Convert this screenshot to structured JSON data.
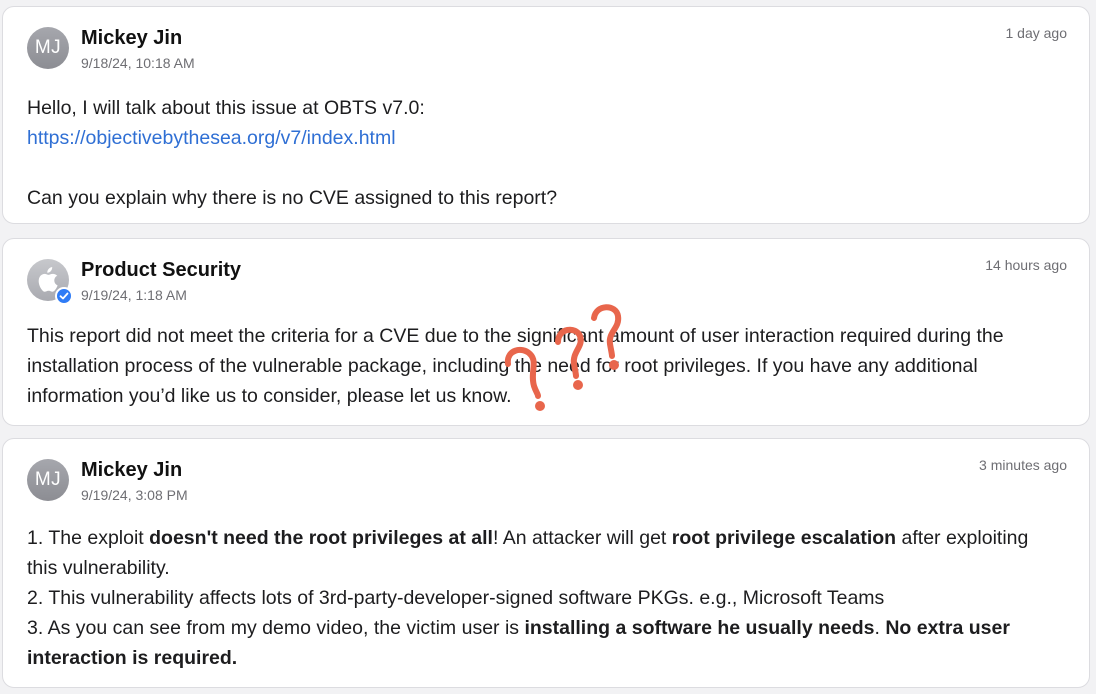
{
  "messages": [
    {
      "author": "Mickey Jin",
      "avatar_initials": "MJ",
      "date": "9/18/24, 10:18 AM",
      "relative_time": "1 day ago",
      "line1": "Hello, I will talk about this issue at OBTS v7.0:",
      "link": "https://objectivebythesea.org/v7/index.html",
      "line3": "Can you explain why there is no CVE assigned to this report?"
    },
    {
      "author": "Product Security",
      "avatar_icon": "apple-logo-icon",
      "verified_icon": "verified-check-icon",
      "date": "9/19/24, 1:18 AM",
      "relative_time": "14 hours ago",
      "text": "This report did not meet the criteria for a CVE due to the significant amount of user interaction required during the installation process of the vulnerable package, including the need for root privileges. If you have any additional information you’d like us to consider, please let us know."
    },
    {
      "author": "Mickey Jin",
      "avatar_initials": "MJ",
      "date": "9/19/24, 3:08 PM",
      "relative_time": "3 minutes ago",
      "p1_a": "1. The exploit ",
      "p1_b": "doesn't need the root privileges at all",
      "p1_c": "! An attacker will get ",
      "p1_d": "root privilege escalation",
      "p1_e": " after exploiting this vulnerability.",
      "p2": "2. This vulnerability affects lots of 3rd-party-developer-signed software PKGs. e.g., Microsoft Teams",
      "p3_a": "3. As you can see from my demo video, the victim user is ",
      "p3_b": "installing a software he usually needs",
      "p3_c": ". ",
      "p3_d": "No extra user interaction is required."
    }
  ],
  "annotation": {
    "icon": "question-marks-icon",
    "color": "#e8664c"
  },
  "colors": {
    "link": "#2f6fd4",
    "verified": "#2f7cf6",
    "muted": "#6e6e73"
  }
}
